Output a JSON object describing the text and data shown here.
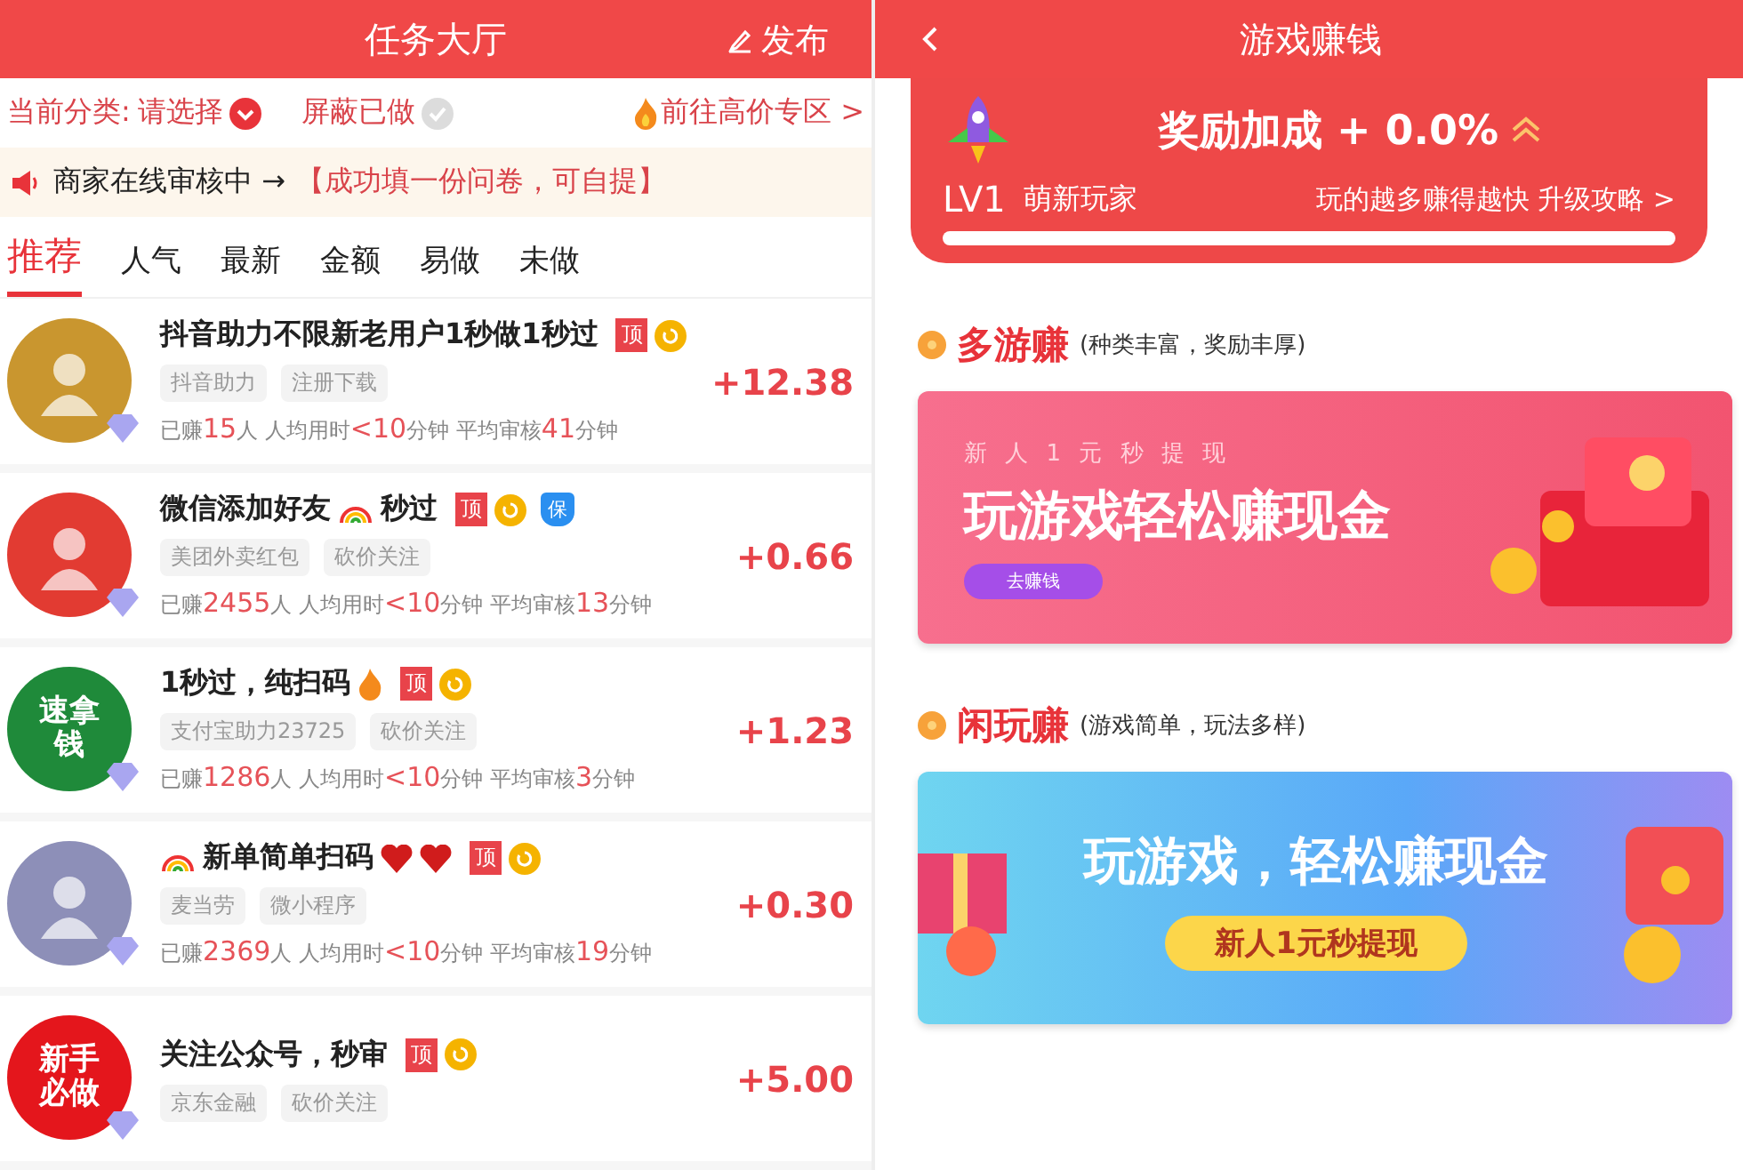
{
  "left": {
    "header": {
      "title": "任务大厅",
      "action": "发布"
    },
    "filters": {
      "category_label": "当前分类:",
      "category_value": "请选择",
      "hide_done": "屏蔽已做",
      "hide_done_checked": false,
      "high_price": "前往高价专区 >"
    },
    "notice": {
      "text": "商家在线审核中 →",
      "highlight": "【成功填一份问卷，可自提】"
    },
    "tabs": [
      {
        "label": "推荐",
        "selected": true
      },
      {
        "label": "人气",
        "selected": false
      },
      {
        "label": "最新",
        "selected": false
      },
      {
        "label": "金额",
        "selected": false
      },
      {
        "label": "易做",
        "selected": false
      },
      {
        "label": "未做",
        "selected": false
      }
    ],
    "tasks": [
      {
        "avatar": {
          "kind": "cartoon",
          "color": "#c9962f"
        },
        "title": [
          {
            "kind": "text",
            "text": "抖音助力不限新老用户1秒做1秒过"
          }
        ],
        "badges": [
          {
            "kind": "top",
            "text": "顶"
          },
          {
            "kind": "refresh"
          }
        ],
        "tags": [
          "抖音助力",
          "注册下载"
        ],
        "reward": "+12.38",
        "stats": [
          {
            "prefix": "已赚",
            "value": "15",
            "suffix": "人"
          },
          {
            "prefix": "人均用时",
            "value": "<10",
            "suffix": "分钟"
          },
          {
            "prefix": "平均审核",
            "value": "41",
            "suffix": "分钟"
          }
        ]
      },
      {
        "avatar": {
          "kind": "figure",
          "color": "#e23b32"
        },
        "title": [
          {
            "kind": "text",
            "text": "微信添加好友"
          },
          {
            "kind": "rainbow"
          },
          {
            "kind": "text",
            "text": "秒过"
          }
        ],
        "badges": [
          {
            "kind": "top",
            "text": "顶"
          },
          {
            "kind": "refresh"
          },
          {
            "kind": "guarantee",
            "text": "保"
          }
        ],
        "tags": [
          "美团外卖红包",
          "砍价关注"
        ],
        "reward": "+0.66",
        "stats": [
          {
            "prefix": "已赚",
            "value": "2455",
            "suffix": "人"
          },
          {
            "prefix": "人均用时",
            "value": "<10",
            "suffix": "分钟"
          },
          {
            "prefix": "平均审核",
            "value": "13",
            "suffix": "分钟"
          }
        ]
      },
      {
        "avatar": {
          "kind": "text",
          "color": "#1f8a3a",
          "text": "速拿钱"
        },
        "title": [
          {
            "kind": "text",
            "text": "1秒过，纯扫码"
          },
          {
            "kind": "fire"
          }
        ],
        "badges": [
          {
            "kind": "top",
            "text": "顶"
          },
          {
            "kind": "refresh"
          }
        ],
        "tags": [
          "支付宝助力23725",
          "砍价关注"
        ],
        "reward": "+1.23",
        "stats": [
          {
            "prefix": "已赚",
            "value": "1286",
            "suffix": "人"
          },
          {
            "prefix": "人均用时",
            "value": "<10",
            "suffix": "分钟"
          },
          {
            "prefix": "平均审核",
            "value": "3",
            "suffix": "分钟"
          }
        ]
      },
      {
        "avatar": {
          "kind": "figure",
          "color": "#8d8fb8"
        },
        "title": [
          {
            "kind": "rainbow"
          },
          {
            "kind": "text",
            "text": "新单简单扫码"
          },
          {
            "kind": "heart"
          },
          {
            "kind": "heart"
          }
        ],
        "badges": [
          {
            "kind": "top",
            "text": "顶"
          },
          {
            "kind": "refresh"
          }
        ],
        "tags": [
          "麦当劳",
          "微小程序"
        ],
        "reward": "+0.30",
        "stats": [
          {
            "prefix": "已赚",
            "value": "2369",
            "suffix": "人"
          },
          {
            "prefix": "人均用时",
            "value": "<10",
            "suffix": "分钟"
          },
          {
            "prefix": "平均审核",
            "value": "19",
            "suffix": "分钟"
          }
        ]
      },
      {
        "avatar": {
          "kind": "text",
          "color": "#e4161c",
          "text": "新手必做"
        },
        "title": [
          {
            "kind": "text",
            "text": "关注公众号，秒审"
          }
        ],
        "badges": [
          {
            "kind": "top",
            "text": "顶"
          },
          {
            "kind": "refresh"
          }
        ],
        "tags": [
          "京东金融",
          "砍价关注"
        ],
        "reward": "+5.00"
      }
    ]
  },
  "right": {
    "header": {
      "title": "游戏赚钱"
    },
    "bonus": {
      "title": "奖励加成 + 0.0%",
      "level": "LV1",
      "rank": "萌新玩家",
      "tip": "玩的越多赚得越快 升级攻略 >",
      "progress": {
        "level": 0
      }
    },
    "sections": [
      {
        "title": "多游赚",
        "subtitle": "(种类丰富，奖励丰厚)",
        "banner": {
          "kind": "pink",
          "caption": "新 人 1 元 秒 提 现",
          "headline": "玩游戏轻松赚现金",
          "button": "去赚钱"
        }
      },
      {
        "title": "闲玩赚",
        "subtitle": "(游戏简单，玩法多样)",
        "banner": {
          "kind": "blue",
          "headline": "玩游戏，轻松赚现金",
          "button": "新人1元秒提现"
        }
      }
    ]
  }
}
